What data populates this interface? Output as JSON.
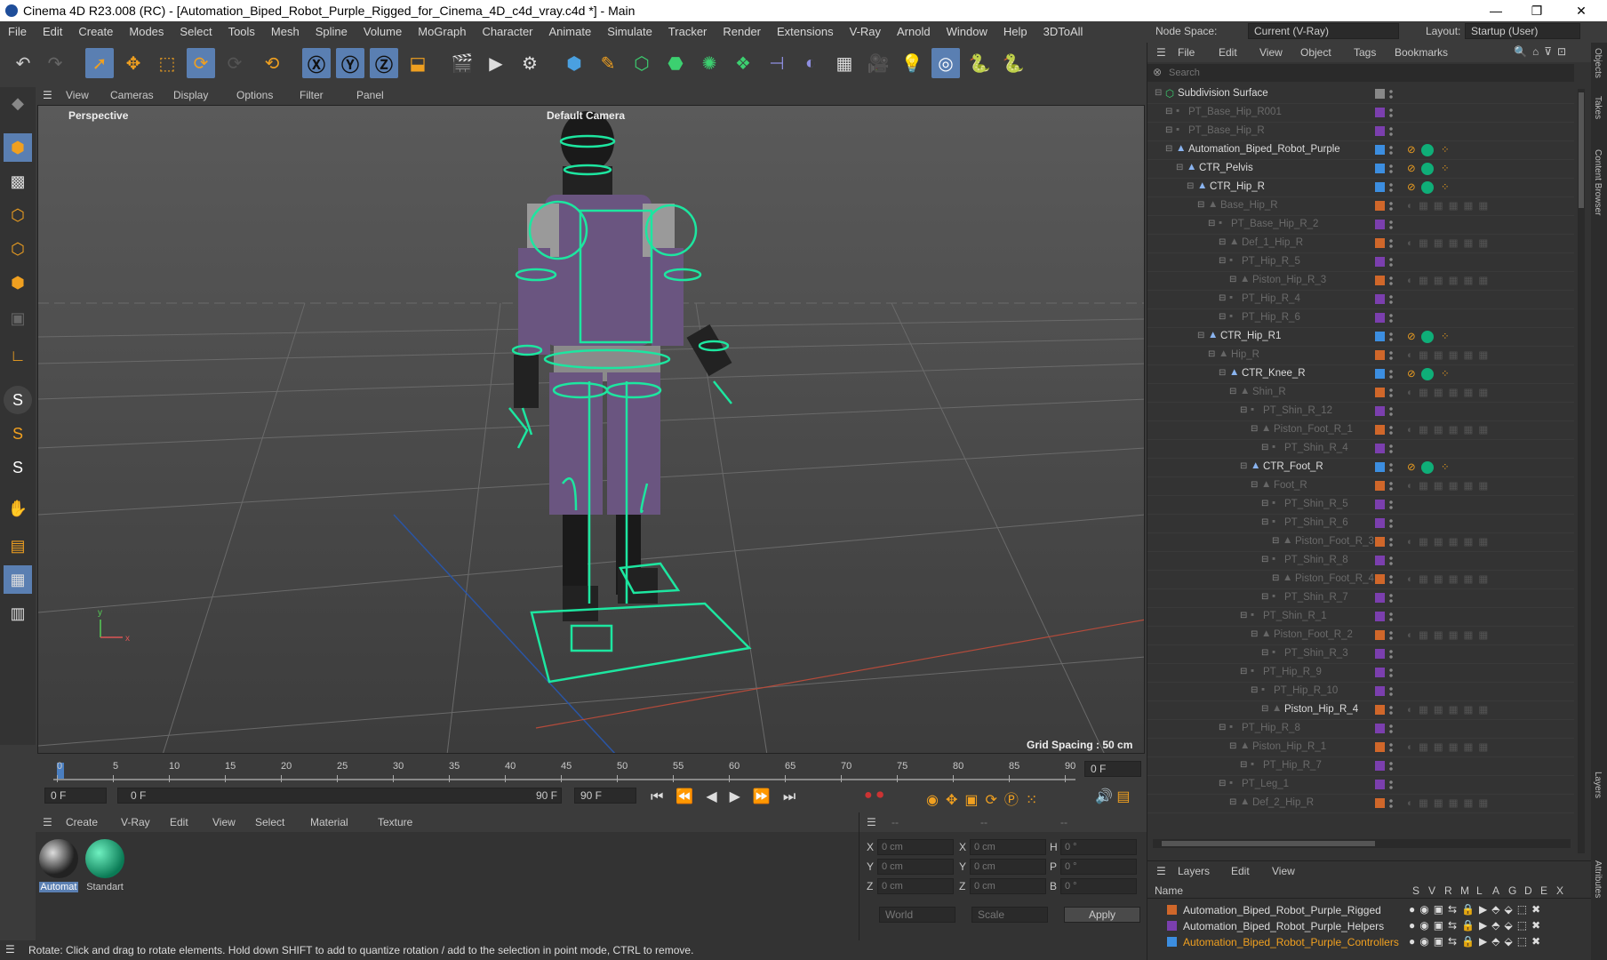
{
  "title": "Cinema 4D R23.008 (RC) - [Automation_Biped_Robot_Purple_Rigged_for_Cinema_4D_c4d_vray.c4d *] - Main",
  "menu": [
    "File",
    "Edit",
    "Create",
    "Modes",
    "Select",
    "Tools",
    "Mesh",
    "Spline",
    "Volume",
    "MoGraph",
    "Character",
    "Animate",
    "Simulate",
    "Tracker",
    "Render",
    "Extensions",
    "V-Ray",
    "Arnold",
    "Window",
    "Help",
    "3DToAll"
  ],
  "nodespace": {
    "label": "Node Space:",
    "value": "Current (V-Ray)",
    "layout_label": "Layout:",
    "layout_value": "Startup (User)"
  },
  "viewport": {
    "menu": [
      "View",
      "Cameras",
      "Display",
      "Options",
      "Filter",
      "Panel"
    ],
    "label": "Perspective",
    "camera": "Default Camera",
    "grid": "Grid Spacing : 50 cm"
  },
  "timeline": {
    "ticks": [
      "0",
      "5",
      "10",
      "15",
      "20",
      "25",
      "30",
      "35",
      "40",
      "45",
      "50",
      "55",
      "60",
      "65",
      "70",
      "75",
      "80",
      "85",
      "90"
    ],
    "frame_box": "0 F",
    "start": "0 F",
    "range_start": "0 F",
    "range_end": "90 F",
    "end": "90 F"
  },
  "material": {
    "menu": [
      "Create",
      "V-Ray",
      "Edit",
      "View",
      "Select",
      "Material",
      "Texture"
    ],
    "items": [
      "Automat",
      "Standart"
    ]
  },
  "coords": {
    "header": "--",
    "rows": [
      {
        "a": "X",
        "v1": "0 cm",
        "b": "X",
        "v2": "0 cm",
        "c": "H",
        "v3": "0 °"
      },
      {
        "a": "Y",
        "v1": "0 cm",
        "b": "Y",
        "v2": "0 cm",
        "c": "P",
        "v3": "0 °"
      },
      {
        "a": "Z",
        "v1": "0 cm",
        "b": "Z",
        "v2": "0 cm",
        "c": "B",
        "v3": "0 °"
      }
    ],
    "world": "World",
    "scale": "Scale",
    "apply": "Apply"
  },
  "status": "Rotate: Click and drag to rotate elements. Hold down SHIFT to add to quantize rotation / add to the selection in point mode, CTRL to remove.",
  "objmenu": [
    "File",
    "Edit",
    "View",
    "Object",
    "Tags",
    "Bookmarks"
  ],
  "search_placeholder": "Search",
  "objects": [
    {
      "name": "Subdivision Surface",
      "indent": 0,
      "dim": false,
      "kind": "sub"
    },
    {
      "name": "PT_Base_Hip_R001",
      "indent": 1,
      "dim": true,
      "kind": "pt"
    },
    {
      "name": "PT_Base_Hip_R",
      "indent": 1,
      "dim": true,
      "kind": "pt"
    },
    {
      "name": "Automation_Biped_Robot_Purple",
      "indent": 1,
      "dim": false,
      "kind": "ctr"
    },
    {
      "name": "CTR_Pelvis",
      "indent": 2,
      "dim": false,
      "kind": "ctr"
    },
    {
      "name": "CTR_Hip_R",
      "indent": 3,
      "dim": false,
      "kind": "ctr"
    },
    {
      "name": "Base_Hip_R",
      "indent": 4,
      "dim": true,
      "kind": "bone"
    },
    {
      "name": "PT_Base_Hip_R_2",
      "indent": 5,
      "dim": true,
      "kind": "pt"
    },
    {
      "name": "Def_1_Hip_R",
      "indent": 6,
      "dim": true,
      "kind": "bone"
    },
    {
      "name": "PT_Hip_R_5",
      "indent": 6,
      "dim": true,
      "kind": "pt"
    },
    {
      "name": "Piston_Hip_R_3",
      "indent": 7,
      "dim": true,
      "kind": "bone"
    },
    {
      "name": "PT_Hip_R_4",
      "indent": 6,
      "dim": true,
      "kind": "pt"
    },
    {
      "name": "PT_Hip_R_6",
      "indent": 6,
      "dim": true,
      "kind": "pt"
    },
    {
      "name": "CTR_Hip_R1",
      "indent": 4,
      "dim": false,
      "kind": "ctr"
    },
    {
      "name": "Hip_R",
      "indent": 5,
      "dim": true,
      "kind": "bone"
    },
    {
      "name": "CTR_Knee_R",
      "indent": 6,
      "dim": false,
      "kind": "ctr"
    },
    {
      "name": "Shin_R",
      "indent": 7,
      "dim": true,
      "kind": "bone"
    },
    {
      "name": "PT_Shin_R_12",
      "indent": 8,
      "dim": true,
      "kind": "pt"
    },
    {
      "name": "Piston_Foot_R_1",
      "indent": 9,
      "dim": true,
      "kind": "bone"
    },
    {
      "name": "PT_Shin_R_4",
      "indent": 10,
      "dim": true,
      "kind": "pt"
    },
    {
      "name": "CTR_Foot_R",
      "indent": 8,
      "dim": false,
      "kind": "ctr"
    },
    {
      "name": "Foot_R",
      "indent": 9,
      "dim": true,
      "kind": "bone"
    },
    {
      "name": "PT_Shin_R_5",
      "indent": 10,
      "dim": true,
      "kind": "pt"
    },
    {
      "name": "PT_Shin_R_6",
      "indent": 10,
      "dim": true,
      "kind": "pt"
    },
    {
      "name": "Piston_Foot_R_3",
      "indent": 11,
      "dim": true,
      "kind": "bone"
    },
    {
      "name": "PT_Shin_R_8",
      "indent": 10,
      "dim": true,
      "kind": "pt"
    },
    {
      "name": "Piston_Foot_R_4",
      "indent": 11,
      "dim": true,
      "kind": "bone"
    },
    {
      "name": "PT_Shin_R_7",
      "indent": 10,
      "dim": true,
      "kind": "pt"
    },
    {
      "name": "PT_Shin_R_1",
      "indent": 8,
      "dim": true,
      "kind": "pt"
    },
    {
      "name": "Piston_Foot_R_2",
      "indent": 9,
      "dim": true,
      "kind": "bone"
    },
    {
      "name": "PT_Shin_R_3",
      "indent": 10,
      "dim": true,
      "kind": "pt"
    },
    {
      "name": "PT_Hip_R_9",
      "indent": 8,
      "dim": true,
      "kind": "pt"
    },
    {
      "name": "PT_Hip_R_10",
      "indent": 9,
      "dim": true,
      "kind": "pt"
    },
    {
      "name": "Piston_Hip_R_4",
      "indent": 10,
      "dim": false,
      "kind": "bone"
    },
    {
      "name": "PT_Hip_R_8",
      "indent": 6,
      "dim": true,
      "kind": "pt"
    },
    {
      "name": "Piston_Hip_R_1",
      "indent": 7,
      "dim": true,
      "kind": "bone"
    },
    {
      "name": "PT_Hip_R_7",
      "indent": 8,
      "dim": true,
      "kind": "pt"
    },
    {
      "name": "PT_Leg_1",
      "indent": 6,
      "dim": true,
      "kind": "pt"
    },
    {
      "name": "Def_2_Hip_R",
      "indent": 7,
      "dim": true,
      "kind": "bone"
    }
  ],
  "layers": {
    "menu": [
      "Layers",
      "Edit",
      "View"
    ],
    "header": "Name",
    "cols": [
      "S",
      "V",
      "R",
      "M",
      "L",
      "A",
      "G",
      "D",
      "E",
      "X"
    ],
    "items": [
      {
        "name": "Automation_Biped_Robot_Purple_Rigged",
        "color": "#d0672a"
      },
      {
        "name": "Automation_Biped_Robot_Purple_Helpers",
        "color": "#7b3fae"
      },
      {
        "name": "Automation_Biped_Robot_Purple_Controllers",
        "color": "#3c8ee0"
      }
    ]
  },
  "side_tabs": [
    "Objects",
    "Takes",
    "Content Browser",
    "Layers",
    "Attributes"
  ],
  "colors": {
    "accent": "#5a7fb2",
    "ctrl_green": "#1de6a0",
    "robot_purple": "#6a5580"
  }
}
